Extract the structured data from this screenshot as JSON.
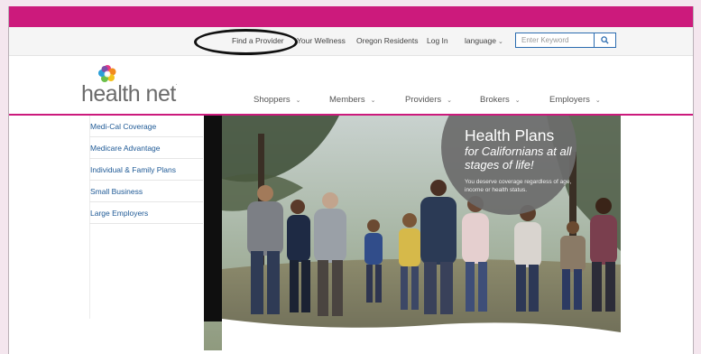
{
  "utility_nav": {
    "links": [
      "Find a Provider",
      "Your Wellness",
      "Oregon Residents",
      "Log In"
    ],
    "language_label": "language",
    "search_placeholder": "Enter Keyword"
  },
  "logo": {
    "text": "health net",
    "tm": "."
  },
  "main_nav": [
    {
      "label": "Shoppers"
    },
    {
      "label": "Members"
    },
    {
      "label": "Providers"
    },
    {
      "label": "Brokers"
    },
    {
      "label": "Employers"
    }
  ],
  "side_menu": [
    "Medi-Cal Coverage",
    "Medicare Advantage",
    "Individual & Family Plans",
    "Small Business",
    "Large Employers"
  ],
  "hero": {
    "title": "Health Plans",
    "subtitle": "for Californians at all stages of life!",
    "description": "You deserve coverage regardless of age, income or health status."
  },
  "colors": {
    "brand": "#cc1a7c",
    "link": "#1f5a96",
    "search_border": "#2b6cb0"
  },
  "icons": [
    "search-icon",
    "chevron-down-icon",
    "health-net-flower-logo"
  ]
}
